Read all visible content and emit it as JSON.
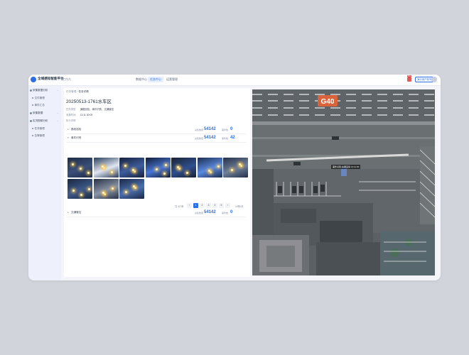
{
  "header": {
    "app_title": "全域感知智能平台",
    "workspace": "工作台",
    "nav": [
      {
        "label": "数据中心",
        "active": false
      },
      {
        "label": "任务中心",
        "active": true
      },
      {
        "label": "运营管理",
        "active": false
      }
    ],
    "notify_count": "99+",
    "user_button": "演示用户账号"
  },
  "sidebar": {
    "items": [
      {
        "label": "采集数据分析",
        "sub": false,
        "chevron": "⌄"
      },
      {
        "label": "文件管理",
        "sub": true
      },
      {
        "label": "事件汇总",
        "sub": true
      },
      {
        "label": "采集数据",
        "sub": false,
        "chevron": "⌄"
      },
      {
        "label": "实况视频分析",
        "sub": false,
        "chevron": "⌄"
      },
      {
        "label": "任务管理",
        "sub": true
      },
      {
        "label": "告警管理",
        "sub": true
      }
    ]
  },
  "breadcrumb": {
    "parent": "任务管理",
    "separator": "/",
    "current": "任务详情"
  },
  "task": {
    "title": "20250513-1761水车区",
    "meta": [
      {
        "label": "任务类型",
        "value": "道路巡检，事件识别，交通管控"
      },
      {
        "label": "采集时间",
        "value": "13:11:30:09"
      },
      {
        "label": "执行详情",
        "value": ""
      }
    ]
  },
  "groups": [
    {
      "toggle": "▸",
      "name": "路段巡检",
      "label1": "采集数量",
      "value1": "54142",
      "label2": "事件数",
      "value2": "0"
    },
    {
      "toggle": "▾",
      "name": "事件识别",
      "label1": "采集数量",
      "value1": "54142",
      "label2": "事件数",
      "value2": "42"
    },
    {
      "toggle": "▸",
      "name": "交通管控",
      "label1": "采集数量",
      "value1": "54142",
      "label2": "事件数",
      "value2": "0"
    }
  ],
  "pager": {
    "total_text": "共 42 条",
    "prev": "‹",
    "pages": [
      "1",
      "2",
      "3",
      "4",
      "5"
    ],
    "current": "1",
    "next": "›",
    "size_text": "10条/页"
  },
  "map": {
    "sign_text": "G40",
    "marker_label": "事件识别-车辆违停 13:11:30"
  },
  "colors": {
    "accent": "#2d6fe6",
    "background": "#d1d4da",
    "sidebar": "#eef0fb"
  }
}
